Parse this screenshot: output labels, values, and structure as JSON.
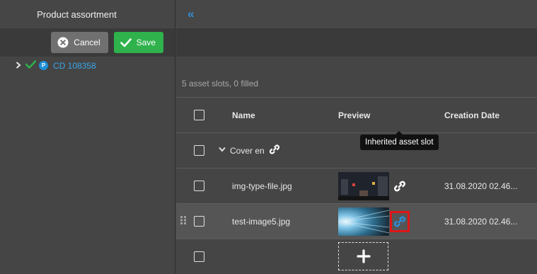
{
  "left_panel": {
    "title": "Product assortment",
    "cancel_label": "Cancel",
    "save_label": "Save",
    "tree_item": {
      "badge": "P",
      "label": "CD 108358"
    }
  },
  "right_panel": {
    "collapse_glyph": "«",
    "summary": "5 asset slots, 0 filled",
    "columns": {
      "name": "Name",
      "preview": "Preview",
      "creation_date": "Creation Date"
    },
    "group": {
      "label": "Cover en"
    },
    "rows": [
      {
        "name": "img-type-file.jpg",
        "date": "31.08.2020 02.46..."
      },
      {
        "name": "test-image5.jpg",
        "date": "31.08.2020 02.46..."
      }
    ],
    "tooltip": "Inherited asset slot",
    "add_glyph": "+"
  },
  "colors": {
    "accent": "#2f8fd8",
    "save": "#2fb24c",
    "highlight": "#e01515"
  }
}
